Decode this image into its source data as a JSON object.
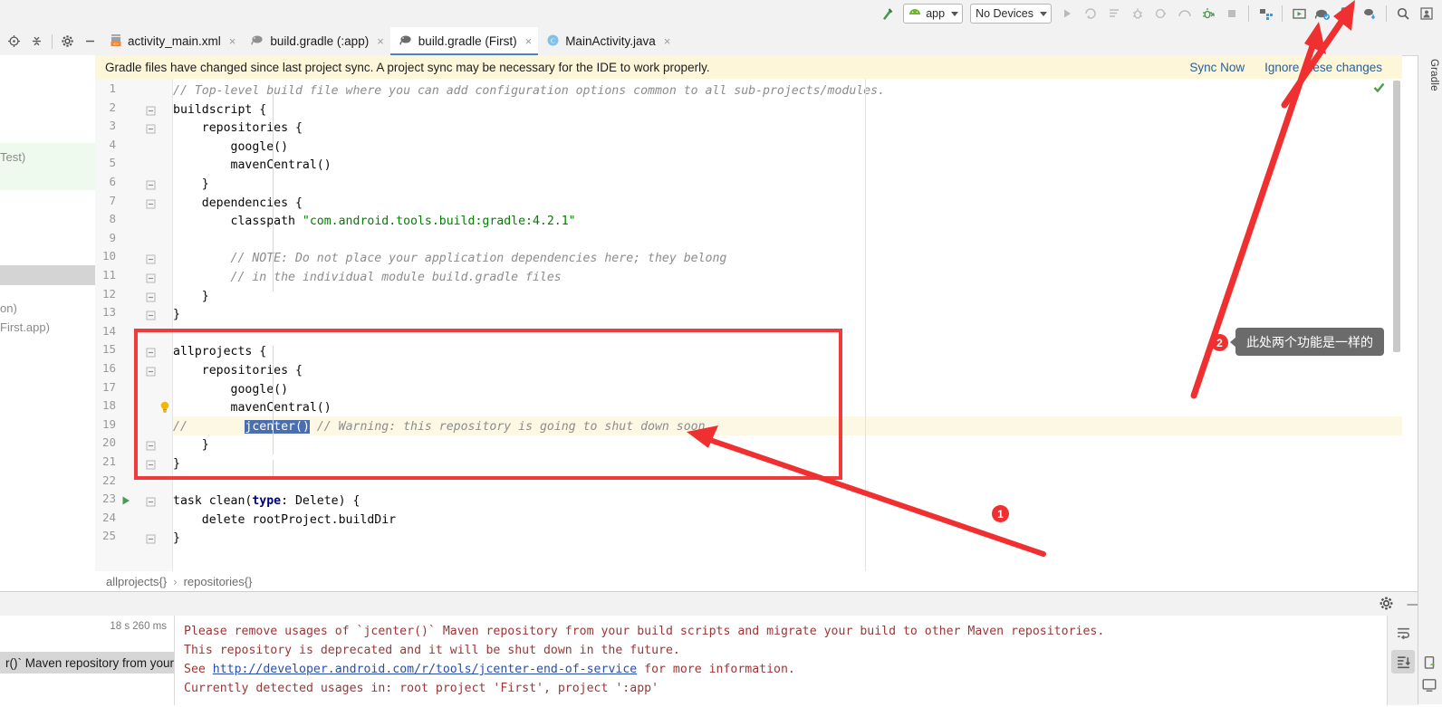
{
  "toolbar": {
    "hammer_icon": "build-hammer-icon",
    "module_selector": {
      "label": "app",
      "icon": "android-head-icon"
    },
    "device_selector": {
      "label": "No Devices"
    },
    "buttons": [
      {
        "name": "run-button",
        "icon": "play-triangle-icon"
      },
      {
        "name": "apply-changes-button",
        "icon": "apply-changes-icon"
      },
      {
        "name": "apply-code-changes-button",
        "icon": "apply-code-changes-icon"
      },
      {
        "name": "debug-button",
        "icon": "bug-icon"
      },
      {
        "name": "run-coverage-button",
        "icon": "coverage-icon"
      },
      {
        "name": "profile-button",
        "icon": "profiler-icon"
      },
      {
        "name": "attach-debugger-button",
        "icon": "attach-debugger-icon"
      },
      {
        "name": "stop-button",
        "icon": "stop-square-icon"
      },
      {
        "name": "sdk-manager-button",
        "icon": "sdk-manager-icon"
      },
      {
        "name": "avd-manager-button",
        "icon": "avd-manager-icon"
      },
      {
        "name": "sync-gradle-button",
        "icon": "gradle-sync-elephant-icon"
      },
      {
        "name": "device-manager-button",
        "icon": "device-phone-icon"
      },
      {
        "name": "sdk-download-button",
        "icon": "sdk-download-icon"
      },
      {
        "name": "search-everywhere-button",
        "icon": "search-icon"
      },
      {
        "name": "account-button",
        "icon": "user-avatar-icon"
      }
    ]
  },
  "tabstrip": {
    "left_icons": [
      {
        "name": "locate-file-icon"
      },
      {
        "name": "collapse-all-icon"
      },
      {
        "name": "settings-gear-icon"
      },
      {
        "name": "hide-panel-icon"
      }
    ],
    "tabs": [
      {
        "label": "activity_main.xml",
        "icon": "xml-layout-file-icon",
        "active": false
      },
      {
        "label": "build.gradle (:app)",
        "icon": "gradle-elephant-icon",
        "active": false
      },
      {
        "label": "build.gradle (First)",
        "icon": "gradle-elephant-icon",
        "active": true
      },
      {
        "label": "MainActivity.java",
        "icon": "java-class-icon",
        "active": false
      }
    ],
    "close_glyph": "×"
  },
  "banner": {
    "message": "Gradle files have changed since last project sync. A project sync may be necessary for the IDE to work properly.",
    "sync_now": "Sync Now",
    "ignore": "Ignore these changes"
  },
  "left_strip": {
    "fragment_1": "Test)",
    "fragment_2": "on)",
    "fragment_3": "First.app)"
  },
  "editor": {
    "line_numbers": [
      1,
      2,
      3,
      4,
      5,
      6,
      7,
      8,
      9,
      10,
      11,
      12,
      13,
      14,
      15,
      16,
      17,
      18,
      19,
      20,
      21,
      22,
      23,
      24,
      25
    ],
    "highlighted_line": 19,
    "selected_token": "jcenter()",
    "lines": [
      {
        "n": 1,
        "text": "// Top-level build file where you can add configuration options common to all sub-projects/modules."
      },
      {
        "n": 2,
        "text": "buildscript {"
      },
      {
        "n": 3,
        "text": "    repositories {"
      },
      {
        "n": 4,
        "text": "        google()"
      },
      {
        "n": 5,
        "text": "        mavenCentral()"
      },
      {
        "n": 6,
        "text": "    }"
      },
      {
        "n": 7,
        "text": "    dependencies {"
      },
      {
        "n": 8,
        "text": "        classpath \"com.android.tools.build:gradle:4.2.1\""
      },
      {
        "n": 9,
        "text": ""
      },
      {
        "n": 10,
        "text": "        // NOTE: Do not place your application dependencies here; they belong"
      },
      {
        "n": 11,
        "text": "        // in the individual module build.gradle files"
      },
      {
        "n": 12,
        "text": "    }"
      },
      {
        "n": 13,
        "text": "}"
      },
      {
        "n": 14,
        "text": ""
      },
      {
        "n": 15,
        "text": "allprojects {"
      },
      {
        "n": 16,
        "text": "    repositories {"
      },
      {
        "n": 17,
        "text": "        google()"
      },
      {
        "n": 18,
        "text": "        mavenCentral()"
      },
      {
        "n": 19,
        "text": "//        jcenter() // Warning: this repository is going to shut down soon"
      },
      {
        "n": 20,
        "text": "    }"
      },
      {
        "n": 21,
        "text": "}"
      },
      {
        "n": 22,
        "text": ""
      },
      {
        "n": 23,
        "text": "task clean(type: Delete) {"
      },
      {
        "n": 24,
        "text": "    delete rootProject.buildDir"
      },
      {
        "n": 25,
        "text": "}"
      }
    ],
    "gutter_icons": [
      {
        "name": "intention-bulb-icon",
        "line": 18
      },
      {
        "name": "run-task-gutter-icon",
        "line": 23
      }
    ],
    "inspection_ok_icon": "inspection-ok-checkmark-icon"
  },
  "breadcrumb": {
    "items": [
      "allprojects{}",
      "repositories{}"
    ],
    "separator": "›"
  },
  "build_panel": {
    "gear_icon": "settings-gear-icon",
    "minimize_icon": "minimize-icon",
    "duration": "18 s 260 ms",
    "tree_row": "r()` Maven repository from your b",
    "console_lines": [
      "Please remove usages of `jcenter()` Maven repository from your build scripts and migrate your build to other Maven repositories.",
      "This repository is deprecated and it will be shut down in the future.",
      "Currently detected usages in: root project 'First', project ':app'"
    ],
    "see_prefix": "See ",
    "see_link": "http://developer.android.com/r/tools/jcenter-end-of-service",
    "see_suffix": " for more information.",
    "side_buttons": [
      {
        "name": "soft-wrap-button",
        "icon": "soft-wrap-icon",
        "active": false
      },
      {
        "name": "scroll-to-end-button",
        "icon": "scroll-to-end-icon",
        "active": true
      }
    ]
  },
  "right_strip": {
    "gradle_label": "Gradle",
    "icons": [
      {
        "name": "device-file-explorer-icon"
      },
      {
        "name": "emulator-icon"
      }
    ]
  },
  "annotations": {
    "badge_1": "1",
    "badge_2": "2",
    "tooltip_2": "此处两个功能是一样的",
    "accent_color": "#f03030"
  },
  "colors": {
    "banner_bg": "#fdf6d8",
    "link": "#2a6099",
    "selection": "#4b6eaf",
    "console_text": "#9c3636",
    "highlight_line": "#fdf8e3"
  }
}
